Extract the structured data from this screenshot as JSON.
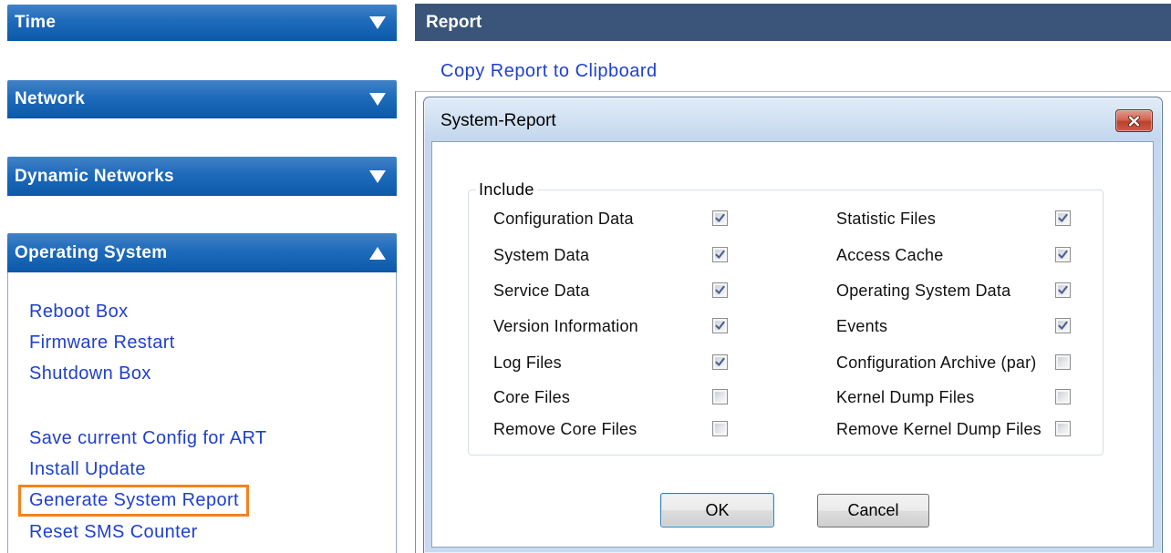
{
  "sidebar": {
    "sections": [
      {
        "title": "Time",
        "expanded": false,
        "arrow_icon": "triangle-down-icon"
      },
      {
        "title": "Network",
        "expanded": false,
        "arrow_icon": "triangle-down-icon"
      },
      {
        "title": "Dynamic Networks",
        "expanded": false,
        "arrow_icon": "triangle-down-icon"
      },
      {
        "title": "Operating System",
        "expanded": true,
        "arrow_icon": "triangle-up-icon"
      }
    ],
    "operating_system_links": [
      {
        "label": "Reboot Box",
        "highlighted": false
      },
      {
        "label": "Firmware Restart",
        "highlighted": false
      },
      {
        "label": "Shutdown Box",
        "highlighted": false
      },
      {
        "label": "Save current Config for ART",
        "highlighted": false
      },
      {
        "label": "Install Update",
        "highlighted": false
      },
      {
        "label": "Generate System Report",
        "highlighted": true
      },
      {
        "label": "Reset SMS Counter",
        "highlighted": false
      }
    ]
  },
  "report": {
    "title": "Report",
    "copy_link": "Copy Report to Clipboard"
  },
  "dialog": {
    "title": "System-Report",
    "close_icon": "close-icon",
    "group_label": "Include",
    "left_options": [
      {
        "label": "Configuration Data",
        "checked": true
      },
      {
        "label": "System Data",
        "checked": true
      },
      {
        "label": "Service Data",
        "checked": true
      },
      {
        "label": "Version Information",
        "checked": true
      },
      {
        "label": "Log Files",
        "checked": true
      },
      {
        "label": "Core Files",
        "checked": false
      },
      {
        "label": "Remove Core Files",
        "checked": false
      }
    ],
    "right_options": [
      {
        "label": "Statistic Files",
        "checked": true
      },
      {
        "label": "Access Cache",
        "checked": true
      },
      {
        "label": "Operating System Data",
        "checked": true
      },
      {
        "label": "Events",
        "checked": true
      },
      {
        "label": "Configuration Archive (par)",
        "checked": false
      },
      {
        "label": "Kernel Dump Files",
        "checked": false
      },
      {
        "label": "Remove Kernel Dump Files",
        "checked": false
      }
    ],
    "ok_label": "OK",
    "cancel_label": "Cancel"
  },
  "colors": {
    "section_header": "#0d5fb6",
    "report_header": "#3b5479",
    "link": "#1f3fcf",
    "highlight": "#f5821f",
    "close_button": "#c7452f"
  }
}
